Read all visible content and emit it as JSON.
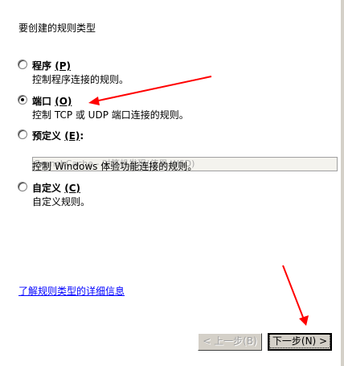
{
  "prompt": "要创建的规则类型",
  "options": [
    {
      "label": "程序",
      "accel": "(P)",
      "suffix": "",
      "desc": "控制程序连接的规则。",
      "selected": false
    },
    {
      "label": "端口",
      "accel": "(O)",
      "suffix": "",
      "desc": "控制 TCP 或 UDP 端口连接的规则。",
      "selected": true
    },
    {
      "label": "预定义",
      "accel": "(E)",
      "suffix": ":",
      "desc": "控制 Windows 体验功能连接的规则。",
      "selected": false,
      "dropdown_value": "BranchCache - 对等机发现(使用 WSD)"
    },
    {
      "label": "自定义",
      "accel": "(C)",
      "suffix": "",
      "desc": "自定义规则。",
      "selected": false
    }
  ],
  "learn_more": "了解规则类型的详细信息",
  "buttons": {
    "back": "< 上一步(B)",
    "next": "下一步(N) >"
  },
  "colors": {
    "link": "#0000ff",
    "arrow": "#ff0000",
    "button_face": "#d4d0c8"
  }
}
